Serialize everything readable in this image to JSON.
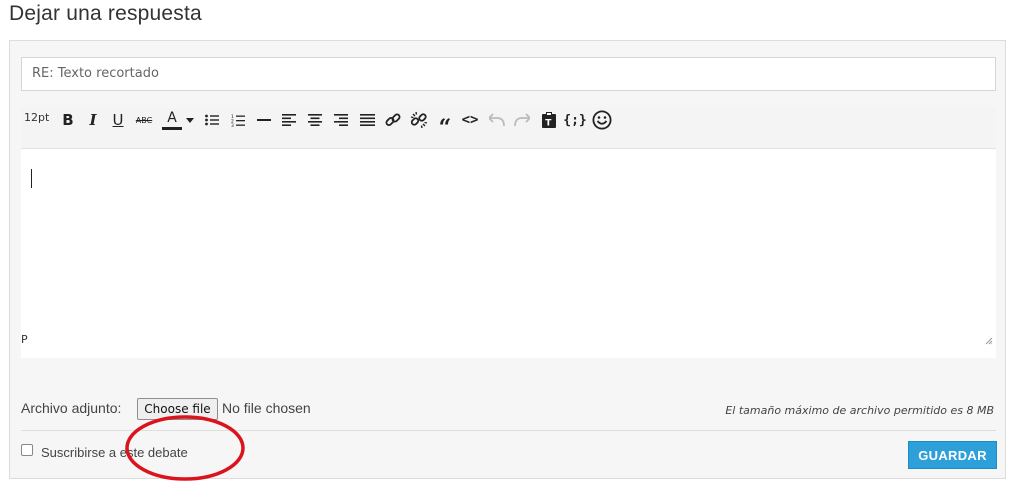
{
  "page": {
    "title": "Dejar una respuesta"
  },
  "form": {
    "subject_value": "RE: Texto recortado",
    "toolbar": {
      "font_size": "12pt",
      "bold": "B",
      "italic": "I",
      "underline": "U",
      "strikethrough": "ABC",
      "text_color": "A",
      "blockquote": "“",
      "code": "<>",
      "curly_code": "{;}",
      "icons": [
        "bold-icon",
        "italic-icon",
        "underline-icon",
        "strikethrough-icon",
        "text-color-icon",
        "bullet-list-icon",
        "numbered-list-icon",
        "horizontal-rule-icon",
        "align-left-icon",
        "align-center-icon",
        "align-right-icon",
        "justify-icon",
        "link-icon",
        "unlink-icon",
        "blockquote-icon",
        "code-icon",
        "undo-icon",
        "redo-icon",
        "paste-text-icon",
        "code-block-icon",
        "emoticon-icon"
      ]
    },
    "editor_path": "P",
    "attachment": {
      "label": "Archivo adjunto:",
      "button_label": "Choose file",
      "status": "No file chosen",
      "max_size_note": "El tamaño máximo de archivo permitido es 8 MB"
    },
    "subscribe_label": "Suscribirse a este debate",
    "submit_label": "GUARDAR"
  },
  "colors": {
    "accent": "#2d9fd9",
    "annotation": "#d9141c"
  }
}
